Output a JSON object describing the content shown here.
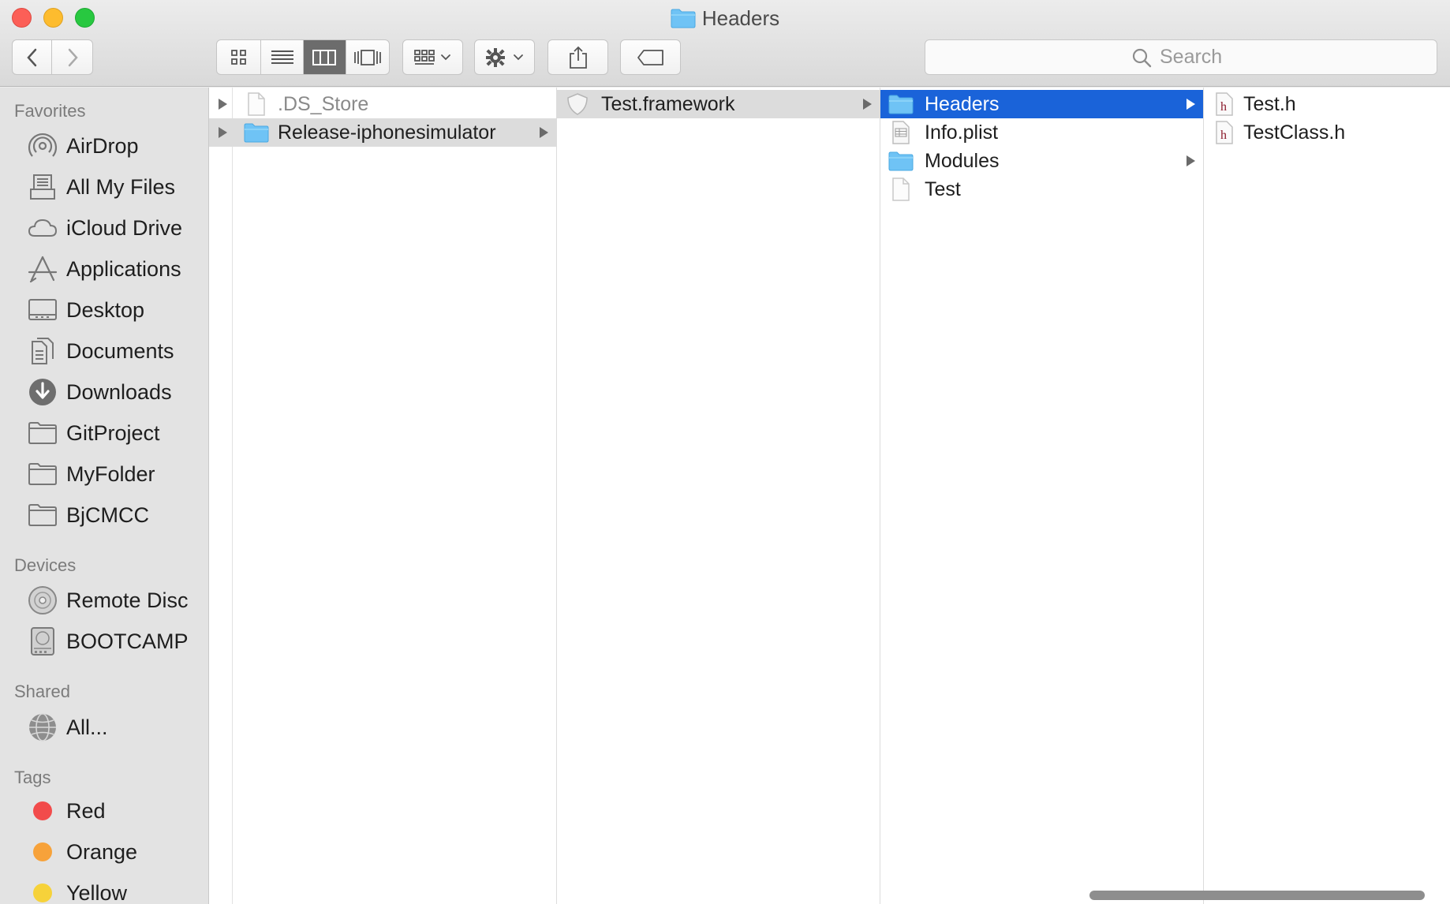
{
  "window": {
    "title": "Headers"
  },
  "toolbar": {
    "back_icon": "chevron-left-icon",
    "forward_icon": "chevron-right-icon",
    "view_modes": [
      "icon-view",
      "list-view",
      "column-view",
      "cover-flow-view"
    ],
    "active_view": "column-view",
    "arrange_icon": "arrange-grid-icon",
    "action_icon": "gear-icon",
    "share_icon": "share-icon",
    "tag_icon": "tag-icon"
  },
  "search": {
    "placeholder": "Search"
  },
  "sidebar": {
    "favorites_heading": "Favorites",
    "favorites": [
      {
        "label": "AirDrop",
        "icon": "airdrop-icon"
      },
      {
        "label": "All My Files",
        "icon": "all-my-files-icon"
      },
      {
        "label": "iCloud Drive",
        "icon": "cloud-icon"
      },
      {
        "label": "Applications",
        "icon": "applications-icon"
      },
      {
        "label": "Desktop",
        "icon": "desktop-icon"
      },
      {
        "label": "Documents",
        "icon": "documents-icon"
      },
      {
        "label": "Downloads",
        "icon": "downloads-icon"
      },
      {
        "label": "GitProject",
        "icon": "folder-icon"
      },
      {
        "label": "MyFolder",
        "icon": "folder-icon"
      },
      {
        "label": "BjCMCC",
        "icon": "folder-icon"
      }
    ],
    "devices_heading": "Devices",
    "devices": [
      {
        "label": "Remote Disc",
        "icon": "disc-icon"
      },
      {
        "label": "BOOTCAMP",
        "icon": "hard-drive-icon"
      }
    ],
    "shared_heading": "Shared",
    "shared": [
      {
        "label": "All...",
        "icon": "network-icon"
      }
    ],
    "tags_heading": "Tags",
    "tags": [
      {
        "label": "Red",
        "color": "#f24b4b"
      },
      {
        "label": "Orange",
        "color": "#f7a23a"
      },
      {
        "label": "Yellow",
        "color": "#f6d23a"
      }
    ]
  },
  "columns": {
    "col1": [
      {
        "label": ".DS_Store",
        "icon": "file-icon",
        "dim": true
      },
      {
        "label": "Release-iphonesimulator",
        "icon": "folder-icon",
        "selected": "grey"
      }
    ],
    "col2": [
      {
        "label": "Test.framework",
        "icon": "framework-icon",
        "selected": "grey"
      }
    ],
    "col3": [
      {
        "label": "Headers",
        "icon": "folder-icon",
        "selected": "blue"
      },
      {
        "label": "Info.plist",
        "icon": "plist-icon"
      },
      {
        "label": "Modules",
        "icon": "folder-icon"
      },
      {
        "label": "Test",
        "icon": "file-icon"
      }
    ],
    "col4": [
      {
        "label": "Test.h",
        "icon": "header-file-icon"
      },
      {
        "label": "TestClass.h",
        "icon": "header-file-icon"
      }
    ]
  },
  "colors": {
    "selection_blue": "#1a63d9",
    "folder_blue": "#6fc3f5"
  }
}
